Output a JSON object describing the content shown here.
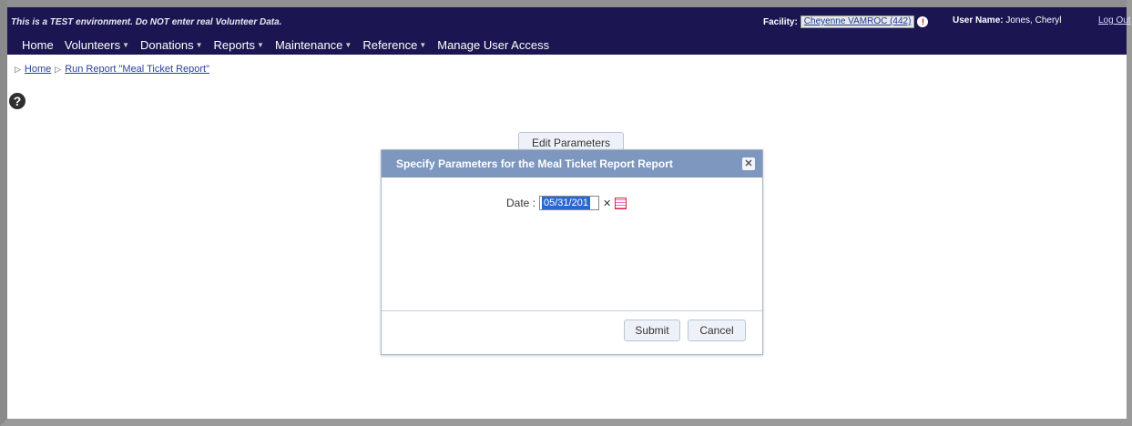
{
  "header": {
    "env_banner": "This is a TEST environment. Do NOT enter real Volunteer Data.",
    "facility_label": "Facility:",
    "facility_value": "Cheyenne VAMROC (442)",
    "user_label": "User Name:",
    "user_value": "Jones, Cheryl",
    "logout": "Log Out"
  },
  "nav": {
    "items": [
      "Home",
      "Volunteers",
      "Donations",
      "Reports",
      "Maintenance",
      "Reference",
      "Manage User Access"
    ]
  },
  "breadcrumb": {
    "home": "Home",
    "current": "Run Report \"Meal Ticket Report\""
  },
  "tab": {
    "label": "Edit Parameters"
  },
  "dialog": {
    "title": "Specify Parameters for the Meal Ticket Report Report",
    "date_label": "Date :",
    "date_value": "05/31/201",
    "submit": "Submit",
    "cancel": "Cancel"
  },
  "colors": {
    "header_bg": "#1b1552",
    "dialog_title_bg": "#7d97bf",
    "selection": "#2a67d4"
  },
  "icons": {
    "help": "help-icon",
    "close": "close-icon",
    "calendar": "calendar-icon"
  }
}
